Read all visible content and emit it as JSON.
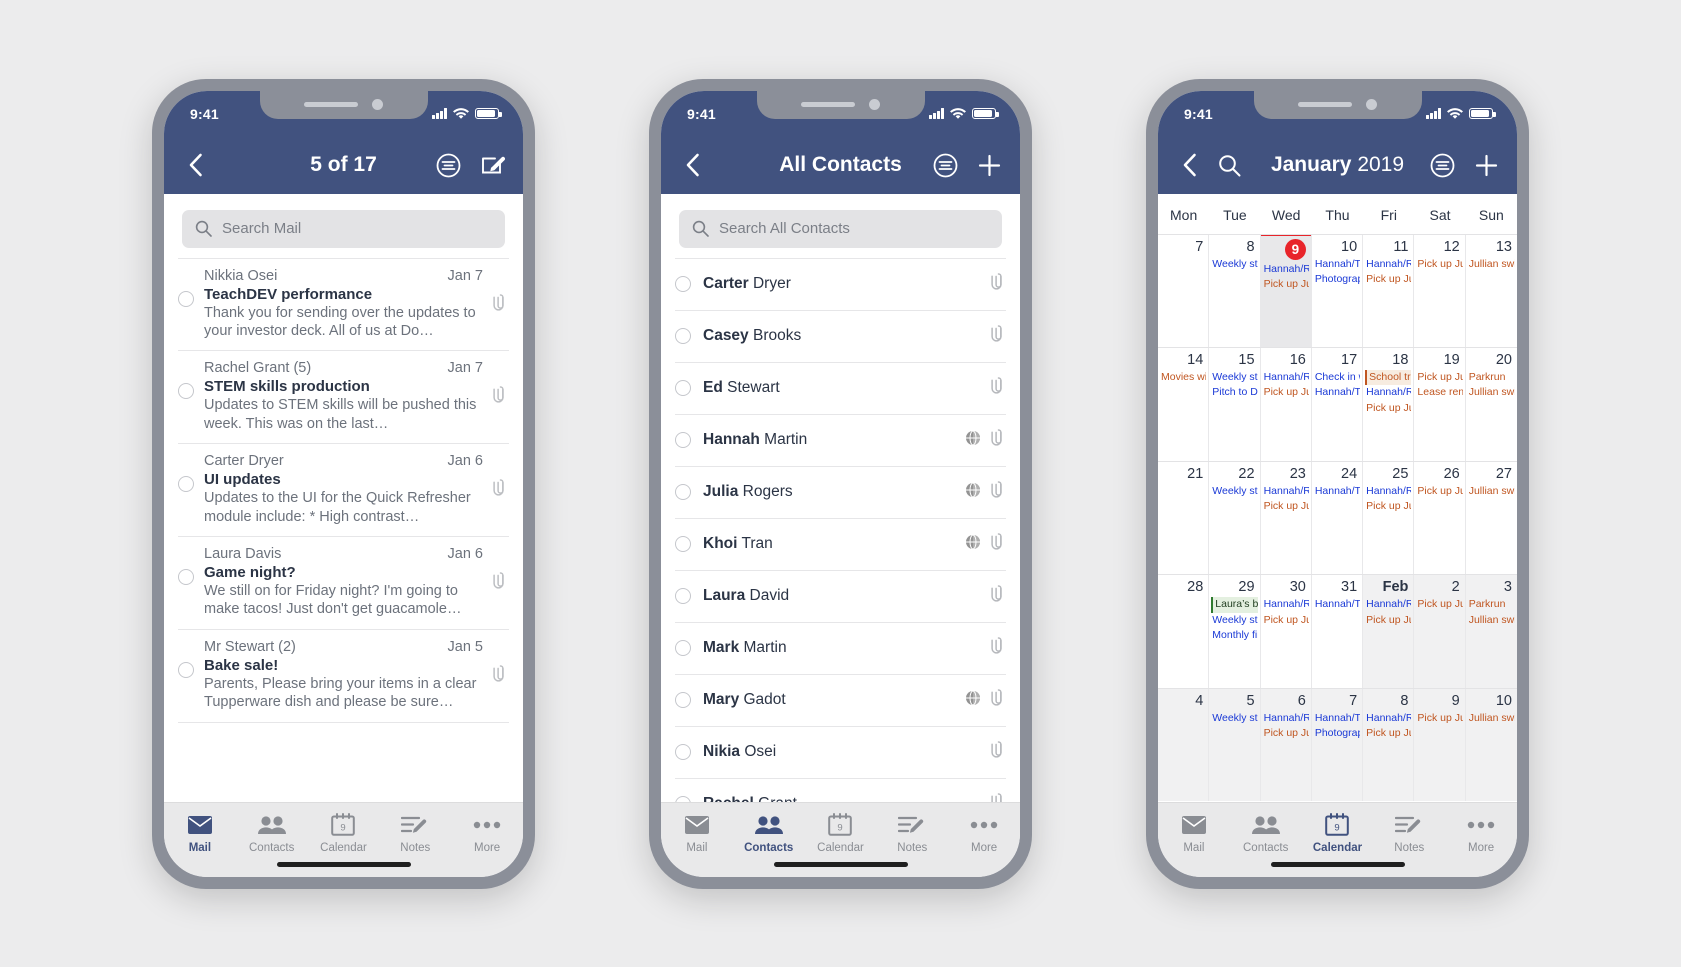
{
  "phones": {
    "mail": {
      "status": {
        "time": "9:41"
      },
      "nav": {
        "title": "5 of 17",
        "back_icon": "chevron-left-icon",
        "filter_icon": "filter-icon",
        "compose_icon": "compose-icon"
      },
      "search": {
        "placeholder": "Search Mail",
        "icon": "search-icon"
      },
      "messages": [
        {
          "sender": "Nikkia Osei",
          "date": "Jan 7",
          "subject": "TeachDEV performance",
          "preview": "Thank you for sending over the updates to your investor deck. All of us at Do…",
          "attachment": true
        },
        {
          "sender": "Rachel Grant (5)",
          "date": "Jan 7",
          "subject": "STEM skills production",
          "preview": "Updates to STEM skills will be pushed this week. This was on the last…",
          "attachment": true
        },
        {
          "sender": "Carter Dryer",
          "date": "Jan 6",
          "subject": "UI updates",
          "preview": "Updates to the UI for the Quick Refresher module include:  * High contrast…",
          "attachment": true
        },
        {
          "sender": "Laura Davis",
          "date": "Jan 6",
          "subject": "Game night?",
          "preview": "We still on for Friday night? I'm going to make tacos! Just don't get guacamole…",
          "attachment": true
        },
        {
          "sender": "Mr Stewart (2)",
          "date": "Jan 5",
          "subject": "Bake sale!",
          "preview": "Parents, Please bring your items in a clear Tupperware dish and please be sure…",
          "attachment": true
        }
      ],
      "tabs": [
        {
          "label": "Mail",
          "icon": "mail-icon",
          "active": true
        },
        {
          "label": "Contacts",
          "icon": "contacts-icon",
          "active": false
        },
        {
          "label": "Calendar",
          "icon": "calendar-icon",
          "active": false
        },
        {
          "label": "Notes",
          "icon": "notes-icon",
          "active": false
        },
        {
          "label": "More",
          "icon": "more-icon",
          "active": false
        }
      ]
    },
    "contacts": {
      "status": {
        "time": "9:41"
      },
      "nav": {
        "title": "All Contacts",
        "back_icon": "chevron-left-icon",
        "filter_icon": "filter-icon",
        "add_icon": "plus-icon"
      },
      "search": {
        "placeholder": "Search All Contacts",
        "icon": "search-icon"
      },
      "contacts": [
        {
          "first": "Carter",
          "last": "Dryer",
          "globe": false,
          "attachment": true
        },
        {
          "first": "Casey",
          "last": "Brooks",
          "globe": false,
          "attachment": true
        },
        {
          "first": "Ed",
          "last": "Stewart",
          "globe": false,
          "attachment": true
        },
        {
          "first": "Hannah",
          "last": "Martin",
          "globe": true,
          "attachment": true
        },
        {
          "first": "Julia",
          "last": "Rogers",
          "globe": true,
          "attachment": true
        },
        {
          "first": "Khoi",
          "last": "Tran",
          "globe": true,
          "attachment": true
        },
        {
          "first": "Laura",
          "last": "David",
          "globe": false,
          "attachment": true
        },
        {
          "first": "Mark",
          "last": "Martin",
          "globe": false,
          "attachment": true
        },
        {
          "first": "Mary",
          "last": "Gadot",
          "globe": true,
          "attachment": true
        },
        {
          "first": "Nikia",
          "last": "Osei",
          "globe": false,
          "attachment": true
        },
        {
          "first": "Rachel",
          "last": "Grant",
          "globe": false,
          "attachment": true
        }
      ],
      "tabs": [
        {
          "label": "Mail",
          "icon": "mail-icon",
          "active": false
        },
        {
          "label": "Contacts",
          "icon": "contacts-icon",
          "active": true
        },
        {
          "label": "Calendar",
          "icon": "calendar-icon",
          "active": false
        },
        {
          "label": "Notes",
          "icon": "notes-icon",
          "active": false
        },
        {
          "label": "More",
          "icon": "more-icon",
          "active": false
        }
      ]
    },
    "calendar": {
      "status": {
        "time": "9:41"
      },
      "nav": {
        "month": "January",
        "year": "2019",
        "back_icon": "chevron-left-icon",
        "search_icon": "search-icon",
        "filter_icon": "filter-icon",
        "add_icon": "plus-icon"
      },
      "weekdays": [
        "Mon",
        "Tue",
        "Wed",
        "Thu",
        "Fri",
        "Sat",
        "Sun"
      ],
      "today": 9,
      "weeks": [
        [
          {
            "num": "7",
            "events": []
          },
          {
            "num": "8",
            "events": [
              {
                "text": "Weekly sta",
                "style": "blue"
              }
            ]
          },
          {
            "num": "9",
            "today": true,
            "events": [
              {
                "text": "Hannah/R",
                "style": "blue"
              },
              {
                "text": "Pick up Jul",
                "style": "orange"
              }
            ]
          },
          {
            "num": "10",
            "events": [
              {
                "text": "Hannah/T",
                "style": "blue"
              },
              {
                "text": "Photograp",
                "style": "blue"
              }
            ]
          },
          {
            "num": "11",
            "events": [
              {
                "text": "Hannah/R",
                "style": "blue"
              },
              {
                "text": "Pick up Ju",
                "style": "orange"
              }
            ]
          },
          {
            "num": "12",
            "events": [
              {
                "text": "Pick up Ju",
                "style": "orange"
              }
            ]
          },
          {
            "num": "13",
            "events": [
              {
                "text": "Jullian swi",
                "style": "orange"
              }
            ]
          }
        ],
        [
          {
            "num": "14",
            "events": [
              {
                "text": "Movies wit",
                "style": "orange"
              }
            ]
          },
          {
            "num": "15",
            "events": [
              {
                "text": "Weekly sta",
                "style": "blue"
              },
              {
                "text": "Pitch to Do",
                "style": "blue"
              }
            ]
          },
          {
            "num": "16",
            "events": [
              {
                "text": "Hannah/R",
                "style": "blue"
              },
              {
                "text": "Pick up Ju",
                "style": "orange"
              }
            ]
          },
          {
            "num": "17",
            "events": [
              {
                "text": "Check in w",
                "style": "blue"
              },
              {
                "text": "Hannah/T",
                "style": "blue"
              }
            ]
          },
          {
            "num": "18",
            "events": [
              {
                "text": "School tri",
                "style": "chip-orange"
              },
              {
                "text": "Hannah/R",
                "style": "blue"
              },
              {
                "text": "Pick up Ju",
                "style": "orange"
              }
            ]
          },
          {
            "num": "19",
            "events": [
              {
                "text": "Pick up Ju",
                "style": "orange"
              },
              {
                "text": "Lease rene",
                "style": "orange"
              }
            ]
          },
          {
            "num": "20",
            "events": [
              {
                "text": "Parkrun",
                "style": "orange"
              },
              {
                "text": "Jullian swi",
                "style": "orange"
              }
            ]
          }
        ],
        [
          {
            "num": "21",
            "events": []
          },
          {
            "num": "22",
            "events": [
              {
                "text": "Weekly sta",
                "style": "blue"
              }
            ]
          },
          {
            "num": "23",
            "events": [
              {
                "text": "Hannah/R",
                "style": "blue"
              },
              {
                "text": "Pick up Jul",
                "style": "orange"
              }
            ]
          },
          {
            "num": "24",
            "events": [
              {
                "text": "Hannah/T",
                "style": "blue"
              }
            ]
          },
          {
            "num": "25",
            "events": [
              {
                "text": "Hannah/R",
                "style": "blue"
              },
              {
                "text": "Pick up Ju",
                "style": "orange"
              }
            ]
          },
          {
            "num": "26",
            "events": [
              {
                "text": "Pick up Ju",
                "style": "orange"
              }
            ]
          },
          {
            "num": "27",
            "events": [
              {
                "text": "Jullian swi",
                "style": "orange"
              }
            ]
          }
        ],
        [
          {
            "num": "28",
            "events": []
          },
          {
            "num": "29",
            "events": [
              {
                "text": "Laura’s bir",
                "style": "chip-green"
              },
              {
                "text": "Weekly sta",
                "style": "blue"
              },
              {
                "text": "Monthly fin",
                "style": "blue"
              }
            ]
          },
          {
            "num": "30",
            "events": [
              {
                "text": "Hannah/R",
                "style": "blue"
              },
              {
                "text": "Pick up Ju",
                "style": "orange"
              }
            ]
          },
          {
            "num": "31",
            "events": [
              {
                "text": "Hannah/T",
                "style": "blue"
              }
            ]
          },
          {
            "num": "Feb",
            "bold": true,
            "dim": true,
            "events": [
              {
                "text": "Hannah/R",
                "style": "blue"
              },
              {
                "text": "Pick up Ju",
                "style": "orange"
              }
            ]
          },
          {
            "num": "2",
            "dim": true,
            "events": [
              {
                "text": "Pick up Ju",
                "style": "orange"
              }
            ]
          },
          {
            "num": "3",
            "dim": true,
            "events": [
              {
                "text": "Parkrun",
                "style": "orange"
              },
              {
                "text": "Jullian swi",
                "style": "orange"
              }
            ]
          }
        ],
        [
          {
            "num": "4",
            "dim": true,
            "events": []
          },
          {
            "num": "5",
            "dim": true,
            "events": [
              {
                "text": "Weekly sta",
                "style": "blue"
              }
            ]
          },
          {
            "num": "6",
            "dim": true,
            "events": [
              {
                "text": "Hannah/R",
                "style": "blue"
              },
              {
                "text": "Pick up Jul",
                "style": "orange"
              }
            ]
          },
          {
            "num": "7",
            "dim": true,
            "events": [
              {
                "text": "Hannah/T",
                "style": "blue"
              },
              {
                "text": "Photograp",
                "style": "blue"
              }
            ]
          },
          {
            "num": "8",
            "dim": true,
            "events": [
              {
                "text": "Hannah/R",
                "style": "blue"
              },
              {
                "text": "Pick up Ju",
                "style": "orange"
              }
            ]
          },
          {
            "num": "9",
            "dim": true,
            "events": [
              {
                "text": "Pick up Ju",
                "style": "orange"
              }
            ]
          },
          {
            "num": "10",
            "dim": true,
            "events": [
              {
                "text": "Jullian swi",
                "style": "orange"
              }
            ]
          }
        ]
      ],
      "tabs": [
        {
          "label": "Mail",
          "icon": "mail-icon",
          "active": false
        },
        {
          "label": "Contacts",
          "icon": "contacts-icon",
          "active": false
        },
        {
          "label": "Calendar",
          "icon": "calendar-icon",
          "active": true
        },
        {
          "label": "Notes",
          "icon": "notes-icon",
          "active": false
        },
        {
          "label": "More",
          "icon": "more-icon",
          "active": false
        }
      ]
    }
  },
  "colors": {
    "nav": "#41527f",
    "today_red": "#e8242a",
    "event_blue": "#1a39d6",
    "event_orange": "#c05621",
    "birthday_green": "#2e7a2e"
  }
}
